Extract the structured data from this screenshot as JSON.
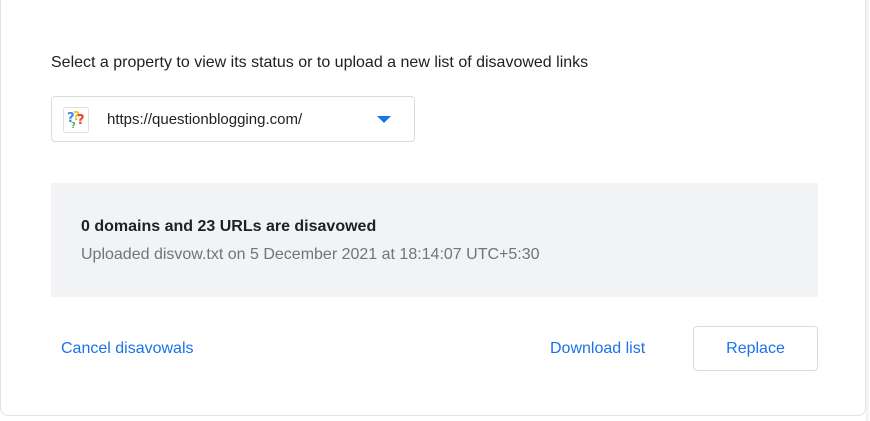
{
  "page": {
    "instruction": "Select a property to view its status or to upload a new list of disavowed links"
  },
  "property_selector": {
    "selected_value": "https://questionblogging.com/",
    "favicon_icon": "question-marks-favicon-icon",
    "arrow_icon": "dropdown-arrow-icon"
  },
  "status": {
    "summary": "0 domains and 23 URLs are disavowed",
    "upload_info": "Uploaded disvow.txt on 5 December 2021 at 18:14:07 UTC+5:30"
  },
  "actions": {
    "cancel_label": "Cancel disavowals",
    "download_label": "Download list",
    "replace_label": "Replace"
  },
  "colors": {
    "accent": "#1a73e8",
    "panel_background": "#f1f3f4",
    "text_primary": "#202124",
    "text_secondary": "#70757a"
  }
}
